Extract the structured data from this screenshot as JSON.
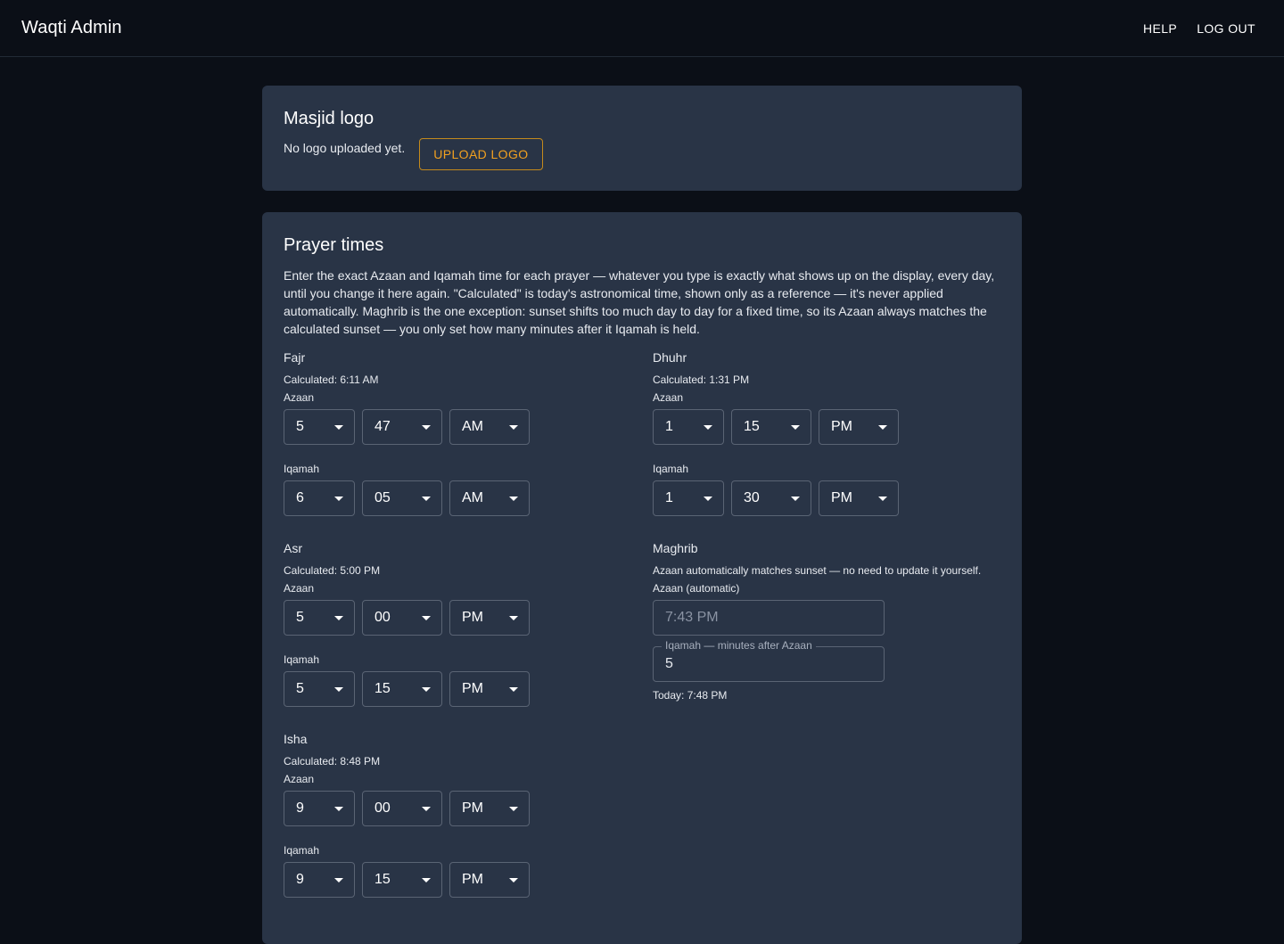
{
  "appbar": {
    "title": "Waqti Admin",
    "help": "HELP",
    "logout": "LOG OUT"
  },
  "logo_card": {
    "title": "Masjid logo",
    "status": "No logo uploaded yet.",
    "upload": "UPLOAD LOGO"
  },
  "prayer_card": {
    "title": "Prayer times",
    "description": "Enter the exact Azaan and Iqamah time for each prayer — whatever you type is exactly what shows up on the display, every day, until you change it here again. \"Calculated\" is today's astronomical time, shown only as a reference — it's never applied automatically. Maghrib is the one exception: sunset shifts too much day to day for a fixed time, so its Azaan always matches the calculated sunset — you only set how many minutes after it Iqamah is held."
  },
  "labels": {
    "azaan": "Azaan",
    "iqamah": "Iqamah"
  },
  "fajr": {
    "name": "Fajr",
    "calculated": "Calculated: 6:11 AM",
    "azaan": {
      "h": "5",
      "m": "47",
      "ampm": "AM"
    },
    "iqamah": {
      "h": "6",
      "m": "05",
      "ampm": "AM"
    }
  },
  "dhuhr": {
    "name": "Dhuhr",
    "calculated": "Calculated: 1:31 PM",
    "azaan": {
      "h": "1",
      "m": "15",
      "ampm": "PM"
    },
    "iqamah": {
      "h": "1",
      "m": "30",
      "ampm": "PM"
    }
  },
  "asr": {
    "name": "Asr",
    "calculated": "Calculated: 5:00 PM",
    "azaan": {
      "h": "5",
      "m": "00",
      "ampm": "PM"
    },
    "iqamah": {
      "h": "5",
      "m": "15",
      "ampm": "PM"
    }
  },
  "maghrib": {
    "name": "Maghrib",
    "note": "Azaan automatically matches sunset — no need to update it yourself.",
    "azaan_label": "Azaan (automatic)",
    "azaan_value": "7:43 PM",
    "iqamah_label": "Iqamah — minutes after Azaan",
    "iqamah_minutes": "5",
    "today": "Today: 7:48 PM"
  },
  "isha": {
    "name": "Isha",
    "calculated": "Calculated: 8:48 PM",
    "azaan": {
      "h": "9",
      "m": "00",
      "ampm": "PM"
    },
    "iqamah": {
      "h": "9",
      "m": "15",
      "ampm": "PM"
    }
  },
  "colors": {
    "background": "#0b0f17",
    "card": "#293446",
    "accent": "#f0a020"
  }
}
